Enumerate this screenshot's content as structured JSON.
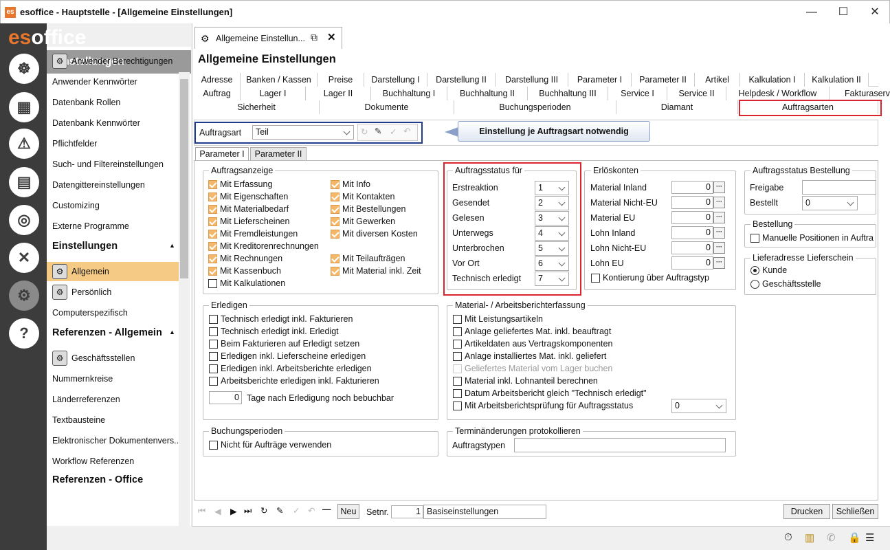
{
  "window": {
    "title": "esoffice - Hauptstelle - [Allgemeine Einstellungen]",
    "logo": "es",
    "minimize": "—",
    "maximize": "☐",
    "close": "✕"
  },
  "rail": {
    "brand_a": "es",
    "brand_b": "office",
    "icons": [
      "helm-icon",
      "calculator-icon",
      "alarm-light-icon",
      "money-icon",
      "headset-icon",
      "tools-icon",
      "gears-icon",
      "help-icon"
    ],
    "glyphs": [
      "☸",
      "▦",
      "⚠",
      "▤",
      "◎",
      "✕",
      "⚙",
      "?"
    ]
  },
  "sidebar": {
    "header": "Einstellungen",
    "sections": [
      {
        "title": "Administration",
        "items": [
          "Anwender Berechtigungen",
          "Anwender Kennwörter",
          "Datenbank Rollen",
          "Datenbank Kennwörter",
          "Pflichtfelder",
          "Such- und Filtereinstellungen",
          "Datengittereinstellungen",
          "Customizing",
          "Externe Programme"
        ]
      },
      {
        "title": "Einstellungen",
        "items": [
          "Allgemein",
          "Persönlich",
          "Computerspezifisch"
        ]
      },
      {
        "title": "Referenzen - Allgemein",
        "items": [
          "Geschäftsstellen",
          "Nummernkreise",
          "Länderreferenzen",
          "Textbausteine",
          "Elektronischer Dokumentenvers...",
          "Workflow Referenzen"
        ]
      },
      {
        "title": "Referenzen - Office",
        "items": []
      }
    ]
  },
  "doc_tab": {
    "label": "Allgemeine Einstellun...",
    "popout": "⧉",
    "close": "✕"
  },
  "page_title": "Allgemeine Einstellungen",
  "tabs": {
    "row1": [
      "Adresse",
      "Banken / Kassen",
      "Preise",
      "Darstellung I",
      "Darstellung II",
      "Darstellung III",
      "Parameter I",
      "Parameter II",
      "Artikel",
      "Kalkulation I",
      "Kalkulation II"
    ],
    "row2": [
      "Auftrag",
      "Lager I",
      "Lager II",
      "Buchhaltung I",
      "Buchhaltung II",
      "Buchhaltung III",
      "Service I",
      "Service II",
      "Helpdesk / Workflow",
      "Fakturaserver"
    ],
    "row3": [
      "Sicherheit",
      "Dokumente",
      "Buchungsperioden",
      "Diamant",
      "Auftragsarten"
    ],
    "active": "Auftragsarten"
  },
  "auftragsart": {
    "label": "Auftragsart",
    "value": "Teil"
  },
  "callout": "Einstellung je Auftragsart notwendig",
  "subtabs": [
    "Parameter I",
    "Parameter II"
  ],
  "auftragsanzeige": {
    "title": "Auftragsanzeige",
    "left": [
      {
        "l": "Mit Erfassung",
        "c": true
      },
      {
        "l": "Mit Eigenschaften",
        "c": true
      },
      {
        "l": "Mit Materialbedarf",
        "c": true
      },
      {
        "l": "Mit Lieferscheinen",
        "c": true
      },
      {
        "l": "Mit Fremdleistungen",
        "c": true
      },
      {
        "l": "Mit Kreditorenrechnungen",
        "c": true
      },
      {
        "l": "Mit Rechnungen",
        "c": true
      },
      {
        "l": "Mit Kassenbuch",
        "c": true
      },
      {
        "l": "Mit Kalkulationen",
        "c": false
      }
    ],
    "right": [
      {
        "l": "Mit Info",
        "c": true
      },
      {
        "l": "Mit Kontakten",
        "c": true
      },
      {
        "l": "Mit Bestellungen",
        "c": true
      },
      {
        "l": "Mit Gewerken",
        "c": true
      },
      {
        "l": "Mit diversen Kosten",
        "c": true
      },
      {
        "l": "Mit Teilaufträgen",
        "c": true
      },
      {
        "l": "Mit Material inkl. Zeit",
        "c": true
      }
    ]
  },
  "auftragsstatus": {
    "title": "Auftragsstatus für",
    "rows": [
      {
        "l": "Erstreaktion",
        "v": "1"
      },
      {
        "l": "Gesendet",
        "v": "2"
      },
      {
        "l": "Gelesen",
        "v": "3"
      },
      {
        "l": "Unterwegs",
        "v": "4"
      },
      {
        "l": "Unterbrochen",
        "v": "5"
      },
      {
        "l": "Vor Ort",
        "v": "6"
      },
      {
        "l": "Technisch erledigt",
        "v": "7"
      }
    ]
  },
  "erloeskonten": {
    "title": "Erlöskonten",
    "rows": [
      {
        "l": "Material Inland",
        "v": "0"
      },
      {
        "l": "Material Nicht-EU",
        "v": "0"
      },
      {
        "l": "Material EU",
        "v": "0"
      },
      {
        "l": "Lohn Inland",
        "v": "0"
      },
      {
        "l": "Lohn Nicht-EU",
        "v": "0"
      },
      {
        "l": "Lohn EU",
        "v": "0"
      }
    ],
    "kontierung": "Kontierung über Auftragstyp",
    "dots": "···"
  },
  "bestellstatus": {
    "title": "Auftragsstatus Bestellung",
    "freigabe_label": "Freigabe",
    "freigabe": "",
    "bestellt_label": "Bestellt",
    "bestellt": "0"
  },
  "bestellung": {
    "title": "Bestellung",
    "item": "Manuelle Positionen in Auftra"
  },
  "lieferadresse": {
    "title": "Lieferadresse Lieferschein",
    "opt1": "Kunde",
    "opt2": "Geschäftsstelle"
  },
  "erledigen": {
    "title": "Erledigen",
    "items": [
      "Technisch erledigt inkl. Fakturieren",
      "Technisch erledigt inkl. Erledigt",
      "Beim Fakturieren auf Erledigt setzen",
      "Erledigen inkl. Lieferscheine erledigen",
      "Erledigen inkl. Arbeitsberichte erledigen",
      "Arbeitsberichte erledigen inkl. Fakturieren"
    ],
    "tage_value": "0",
    "tage_label": "Tage nach Erledigung noch bebuchbar"
  },
  "material": {
    "title": "Material- / Arbeitsberichterfassung",
    "items": [
      {
        "l": "Mit Leistungsartikeln",
        "d": false
      },
      {
        "l": "Anlage geliefertes Mat. inkl. beauftragt",
        "d": false
      },
      {
        "l": "Artikeldaten aus Vertragskomponenten",
        "d": false
      },
      {
        "l": "Anlage installiertes Mat. inkl. geliefert",
        "d": false
      },
      {
        "l": "Geliefertes Material vom Lager buchen",
        "d": true
      },
      {
        "l": "Material inkl. Lohnanteil berechnen",
        "d": false
      },
      {
        "l": "Datum Arbeitsbericht gleich \"Technisch erledigt\"",
        "d": false
      },
      {
        "l": "Mit Arbeitsberichtsprüfung für Auftragsstatus",
        "d": false
      }
    ],
    "pruef_value": "0"
  },
  "buchungsperioden": {
    "title": "Buchungsperioden",
    "item": "Nicht für Aufträge verwenden"
  },
  "termin": {
    "title": "Terminänderungen protokollieren",
    "label": "Auftragstypen",
    "value": ""
  },
  "toolbar": {
    "neu": "Neu",
    "setnr_label": "Setnr.",
    "setnr": "1",
    "setname": "Basiseinstellungen",
    "drucken": "Drucken",
    "schliessen": "Schließen"
  },
  "statusbar": [
    "stopwatch-icon",
    "building-icon",
    "phone-icon",
    "lock-icon",
    "database-icon"
  ]
}
